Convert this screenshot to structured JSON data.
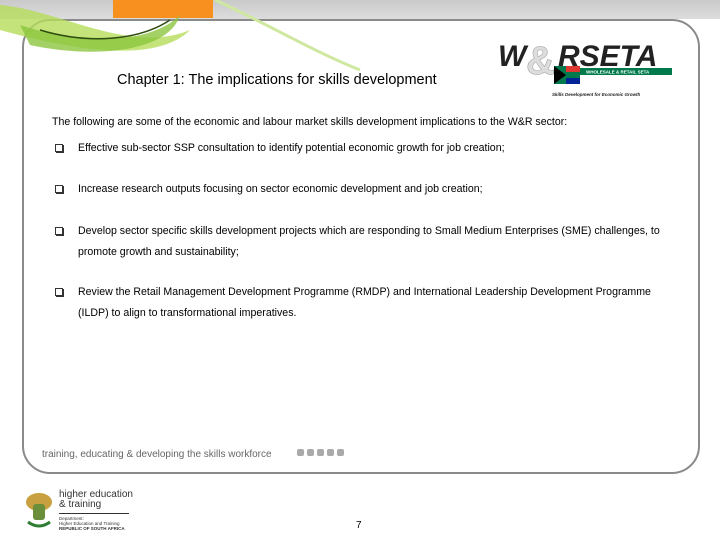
{
  "header": {
    "title": "Chapter 1: The implications for skills development"
  },
  "logo": {
    "name": "W&RSETA",
    "banner": "WHOLESALE & RETAIL SETA",
    "tagline": "Skills Development for Economic Growth"
  },
  "body": {
    "intro": "The following are some of the economic and labour market skills development implications to the W&R sector:",
    "items": [
      "Effective sub-sector SSP consultation to identify potential economic growth for job creation;",
      "Increase research outputs focusing on sector economic development and job creation;",
      "Develop sector specific skills development projects which are responding to Small Medium Enterprises (SME) challenges, to promote growth and sustainability;",
      "Review the Retail Management Development Programme (RMDP) and International Leadership Development Programme (ILDP) to align to transformational imperatives."
    ]
  },
  "footer": {
    "tagline": "training, educating & developing the skills workforce",
    "page_number": "7",
    "dhet": {
      "line1": "higher education",
      "line2": "& training",
      "line3": "Department:",
      "line4": "Higher Education and Training",
      "line5": "REPUBLIC OF SOUTH AFRICA"
    }
  },
  "colors": {
    "accent": "#f7901e",
    "green": "#8cc63f"
  }
}
